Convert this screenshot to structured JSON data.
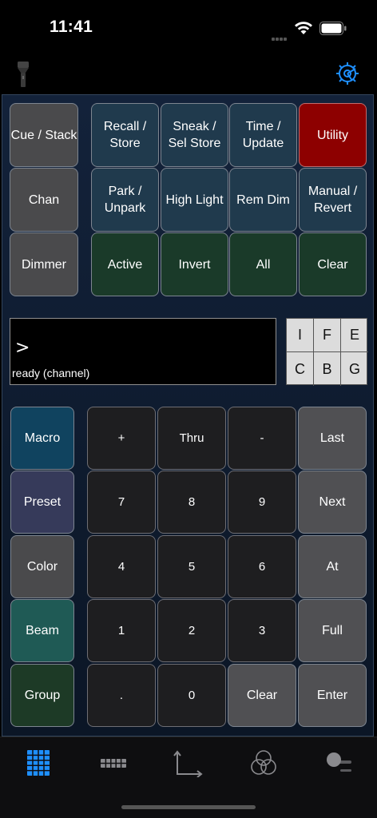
{
  "status_bar": {
    "time": "11:41"
  },
  "top_row": {
    "cue_stack": "Cue / Stack",
    "recall_store": "Recall /\nStore",
    "sneak_sel_store": "Sneak /\nSel Store",
    "time_update": "Time /\nUpdate",
    "utility": "Utility",
    "chan": "Chan",
    "park_unpark": "Park /\nUnpark",
    "high_light": "High Light",
    "rem_dim": "Rem Dim",
    "manual_revert": "Manual /\nRevert",
    "dimmer": "Dimmer",
    "active": "Active",
    "invert": "Invert",
    "all": "All",
    "clear": "Clear"
  },
  "command_line": {
    "prompt": ">",
    "status": "ready (channel)"
  },
  "selector_grid": [
    "I",
    "F",
    "E",
    "C",
    "B",
    "G"
  ],
  "side_keys": {
    "macro": "Macro",
    "preset": "Preset",
    "color": "Color",
    "beam": "Beam",
    "group": "Group"
  },
  "keypad": {
    "plus": "+",
    "thru": "Thru",
    "minus": "-",
    "last": "Last",
    "k7": "7",
    "k8": "8",
    "k9": "9",
    "next": "Next",
    "k4": "4",
    "k5": "5",
    "k6": "6",
    "at": "At",
    "k1": "1",
    "k2": "2",
    "k3": "3",
    "full": "Full",
    "dot": ".",
    "k0": "0",
    "clear": "Clear",
    "enter": "Enter"
  },
  "colors": {
    "accent": "#1e8fff",
    "utility": "#8d0000"
  },
  "icons": {
    "flashlight": "flashlight-icon",
    "settings": "gear-icon",
    "tab_keypad": "grid-icon",
    "tab_faders": "fader-bank-icon",
    "tab_axes": "axes-icon",
    "tab_color": "color-circles-icon",
    "tab_toggle": "toggle-icon"
  }
}
